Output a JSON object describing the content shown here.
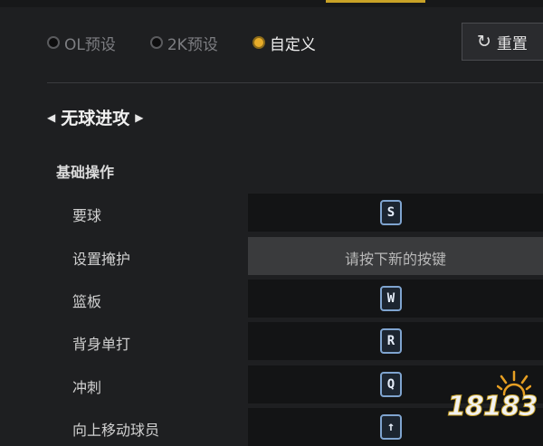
{
  "presets": [
    {
      "label": "OL预设",
      "active": false
    },
    {
      "label": "2K预设",
      "active": false
    },
    {
      "label": "自定义",
      "active": true
    }
  ],
  "reset": {
    "label": "重置",
    "icon": "refresh-icon"
  },
  "section": {
    "title": "无球进攻"
  },
  "subsection": {
    "title": "基础操作"
  },
  "rows": [
    {
      "label": "要球",
      "key": "S"
    },
    {
      "label": "设置掩护",
      "prompt": "请按下新的按键"
    },
    {
      "label": "篮板",
      "key": "W"
    },
    {
      "label": "背身单打",
      "key": "R"
    },
    {
      "label": "冲刺",
      "key": "Q"
    },
    {
      "label": "向上移动球员",
      "key": "↑"
    }
  ],
  "watermark": {
    "text": "18183"
  },
  "colors": {
    "accent": "#e8ad2a",
    "keycap_border": "#7fa4cf",
    "background": "#1e1f21"
  }
}
